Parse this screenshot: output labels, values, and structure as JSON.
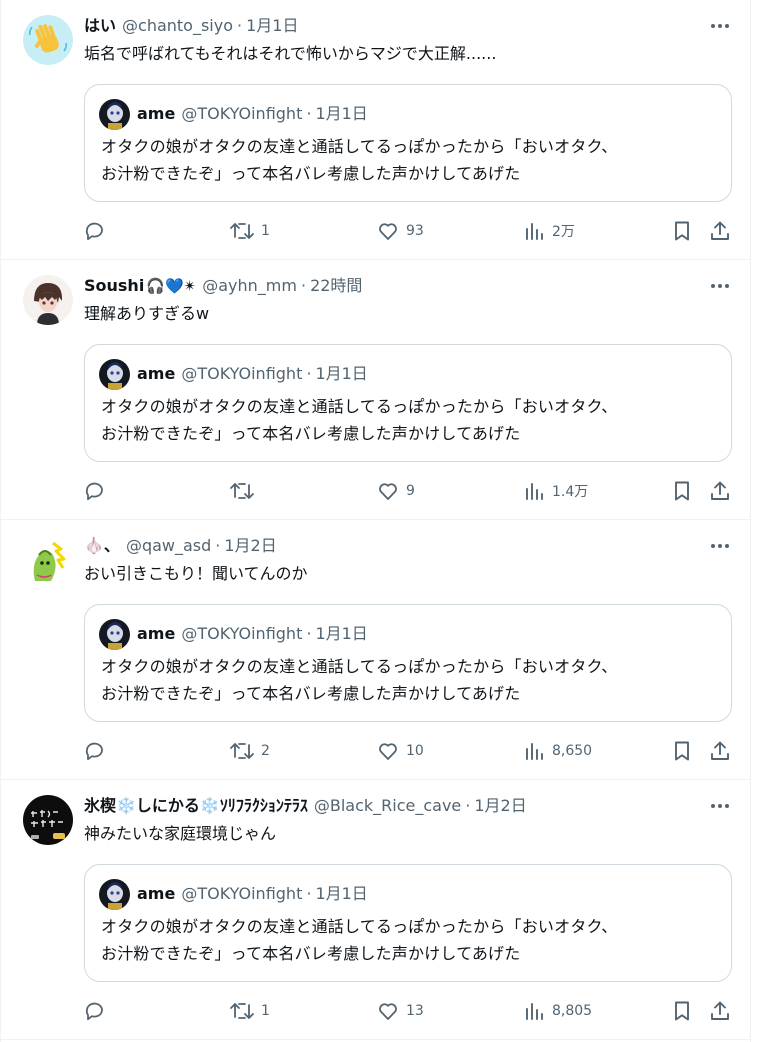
{
  "quoted": {
    "name": "ame",
    "handle": "@TOKYOinfight",
    "time": "1月1日",
    "line1": "オタクの娘がオタクの友達と通話してるっぽかったから「おいオタク、",
    "line2": "お汁粉できたぞ」って本名バレ考慮した声かけしてあげた"
  },
  "posts": [
    {
      "name": "はい",
      "name_emojis": "",
      "handle": "@chanto_siyo",
      "time": "1月1日",
      "text": "垢名で呼ばれてもそれはそれで怖いからマジで大正解......",
      "replies": "",
      "retweets": "1",
      "likes": "93",
      "views": "2万",
      "avatar_icon": "waving-hand-icon"
    },
    {
      "name": "Soushi",
      "name_emojis": "🎧💙✴",
      "handle": "@ayhn_mm",
      "time": "22時間",
      "text": "理解ありすぎるw",
      "replies": "",
      "retweets": "",
      "likes": "9",
      "views": "1.4万",
      "avatar_icon": "anime-character-avatar"
    },
    {
      "name": "🧄、",
      "name_emojis": "",
      "handle": "@qaw_asd",
      "time": "1月2日",
      "text": "おい引きこもり！聞いてんのか",
      "replies": "",
      "retweets": "2",
      "likes": "10",
      "views": "8,650",
      "avatar_icon": "green-character-avatar"
    },
    {
      "name": "氷楔❄️しにかる❄️ｿﾘﾌﾗｸｼｮﾝﾃﾗｽ",
      "name_emojis": "",
      "handle": "@Black_Rice_cave",
      "time": "1月2日",
      "text": "神みたいな家庭環境じゃん",
      "replies": "",
      "retweets": "1",
      "likes": "13",
      "views": "8,805",
      "avatar_icon": "dark-chalkboard-avatar"
    }
  ],
  "colors": {
    "text": "#0f1419",
    "secondary": "#536471",
    "border": "#cfd9de",
    "divider": "#eff3f4"
  }
}
